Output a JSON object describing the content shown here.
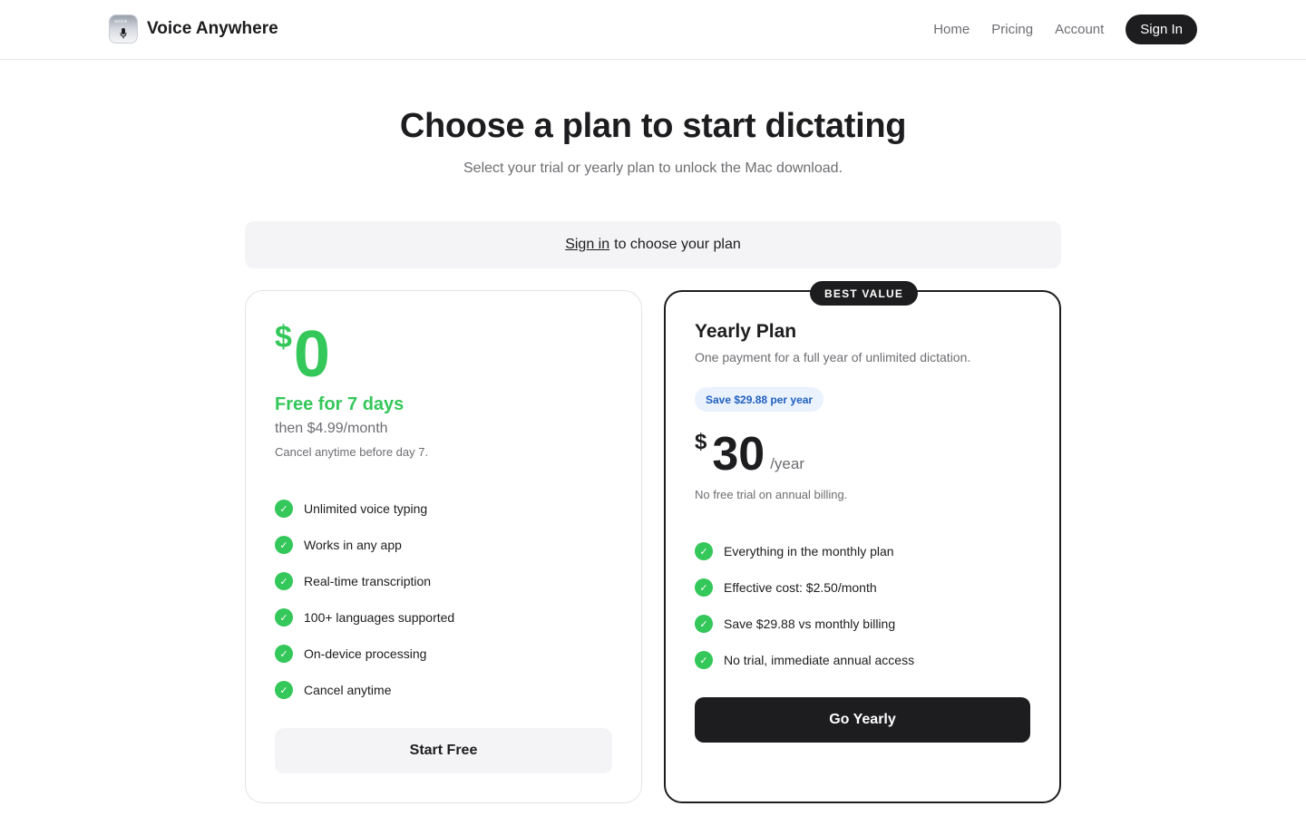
{
  "header": {
    "logo_caption": "voice",
    "brand_name": "Voice Anywhere",
    "nav": [
      "Home",
      "Pricing",
      "Account"
    ],
    "sign_in_button": "Sign In"
  },
  "hero": {
    "title": "Choose a plan to start dictating",
    "subtitle": "Select your trial or yearly plan to unlock the Mac download."
  },
  "banner": {
    "link_text": "Sign in",
    "text": "to choose your plan"
  },
  "free_plan": {
    "currency": "$",
    "price": "0",
    "headline": "Free for 7 days",
    "then": "then $4.99/month",
    "note": "Cancel anytime before day 7.",
    "features": [
      "Unlimited voice typing",
      "Works in any app",
      "Real-time transcription",
      "100+ languages supported",
      "On-device processing",
      "Cancel anytime"
    ],
    "button": "Start Free"
  },
  "yearly_plan": {
    "badge": "BEST VALUE",
    "title": "Yearly Plan",
    "description": "One payment for a full year of unlimited dictation.",
    "save_pill": "Save $29.88 per year",
    "currency": "$",
    "price": "30",
    "period": "/year",
    "note": "No free trial on annual billing.",
    "features": [
      "Everything in the monthly plan",
      "Effective cost: $2.50/month",
      "Save $29.88 vs monthly billing",
      "No trial, immediate annual access"
    ],
    "button": "Go Yearly"
  },
  "icons": {
    "check": "check-icon",
    "microphone": "microphone-icon"
  },
  "colors": {
    "accent_green": "#34c759",
    "primary_dark": "#1d1d1f",
    "save_pill_bg": "#eaf2fd",
    "save_pill_text": "#1f5fbf"
  }
}
